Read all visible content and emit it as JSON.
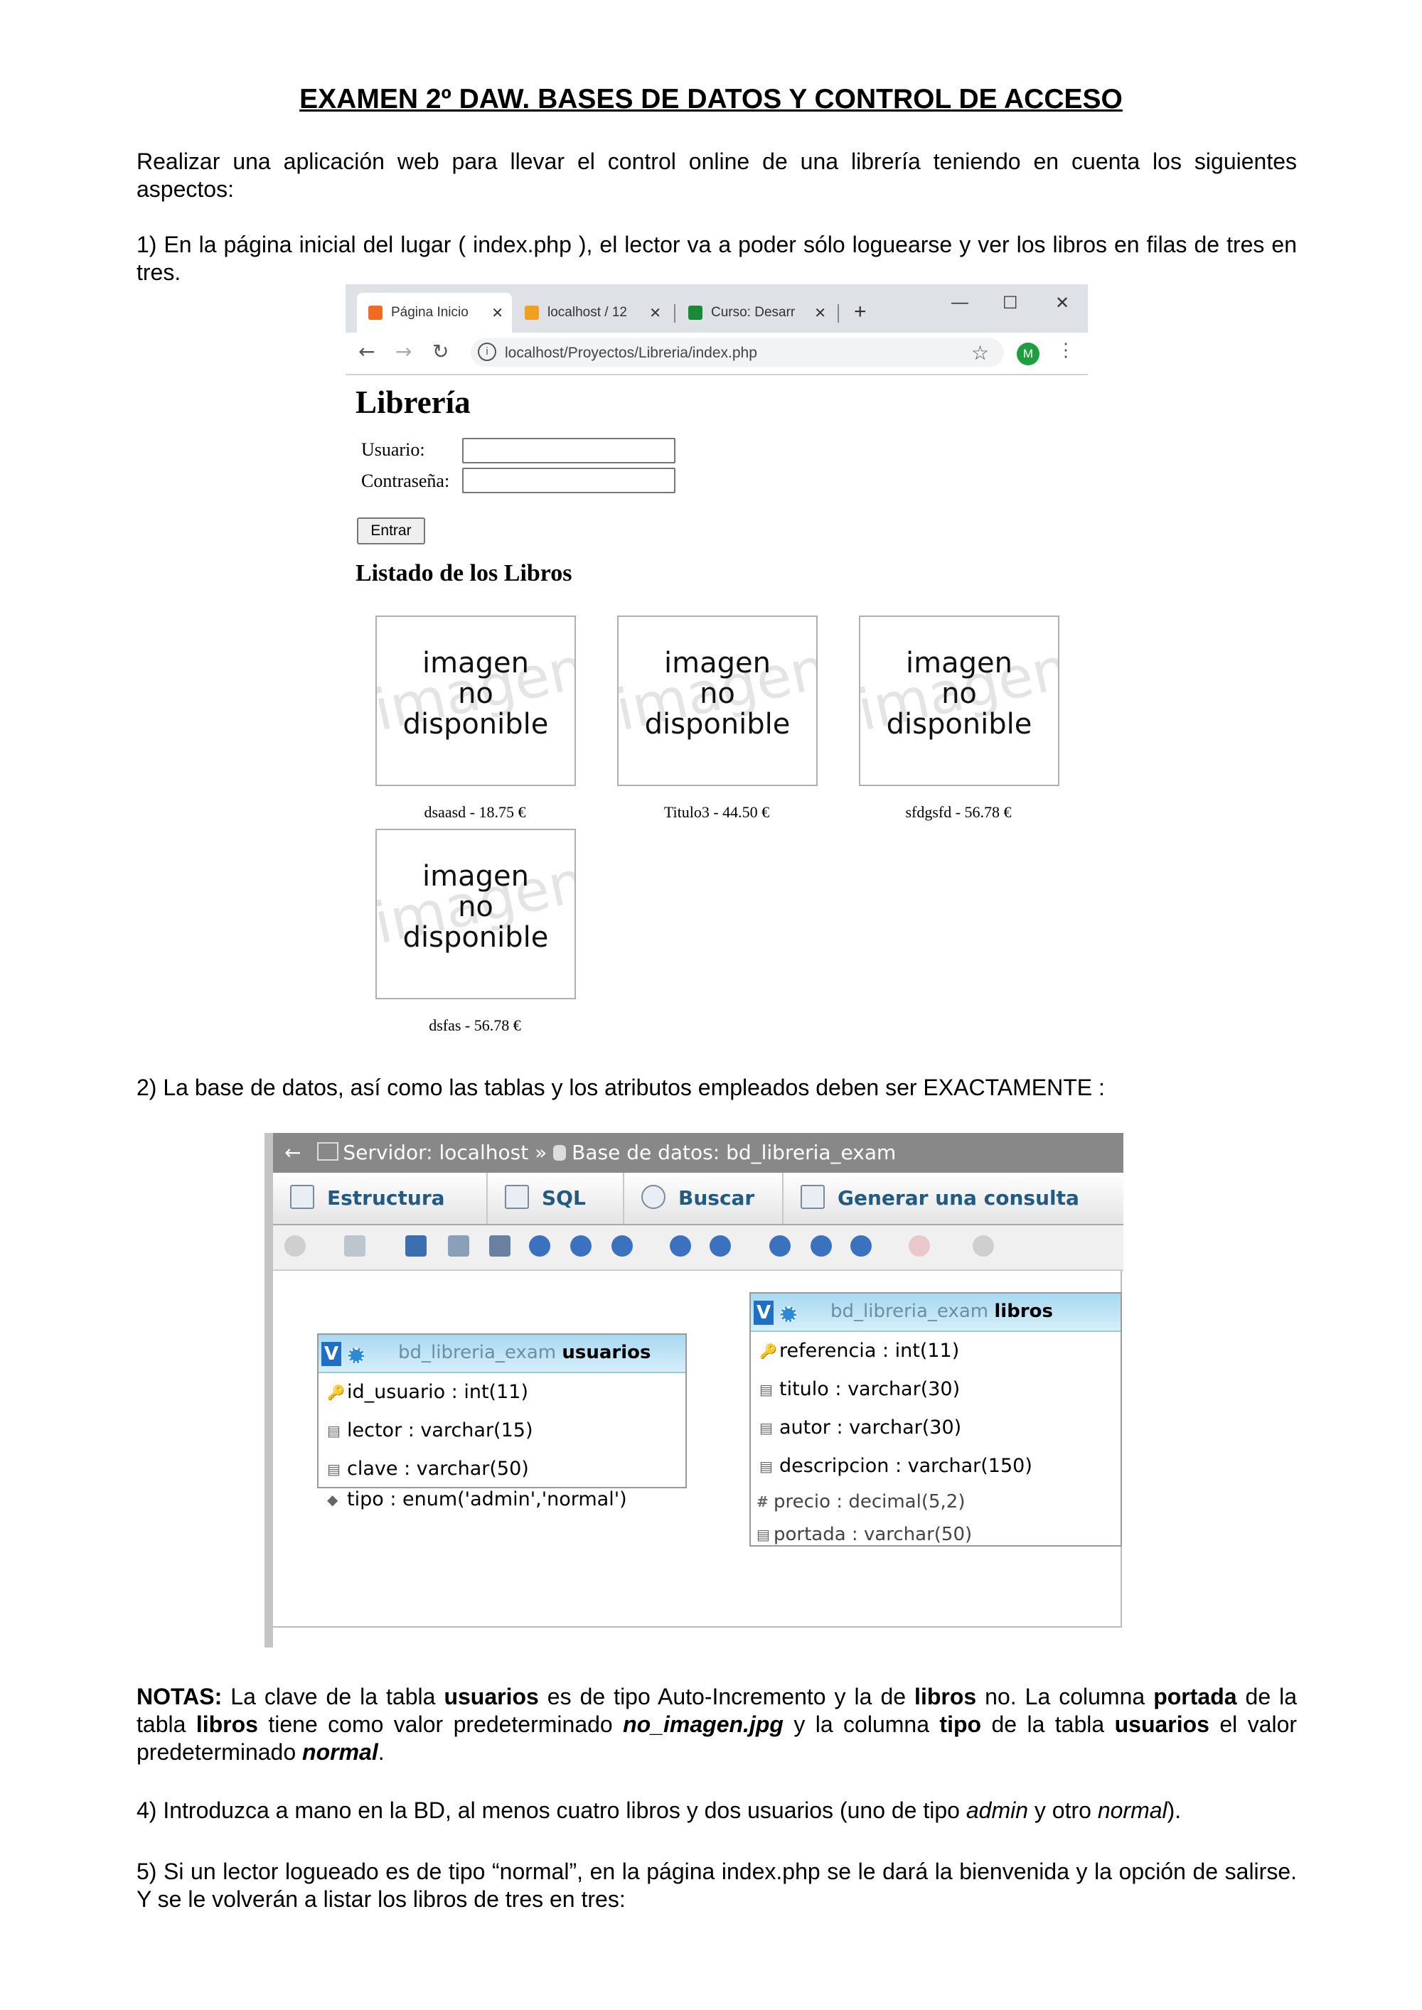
{
  "doc": {
    "title": "EXAMEN 2º DAW. BASES DE DATOS Y CONTROL DE ACCESO",
    "intro": "Realizar una aplicación web para llevar el control online de una librería teniendo en cuenta los siguientes aspectos:",
    "p1": "1) En la página inicial del lugar ( index.php ), el lector va a poder sólo loguearse y ver los libros en filas  de tres en tres.",
    "p2": "2) La base de datos, así como las tablas y los atributos empleados deben ser EXACTAMENTE :",
    "notes": {
      "label": "NOTAS:",
      "t1": " La clave de la tabla ",
      "b1": "usuarios",
      "t2": " es de tipo Auto-Incremento y la de ",
      "b2": "libros",
      "t3": " no. La columna ",
      "b3": "portada",
      "t4": " de la tabla ",
      "b4": "libros",
      "t5": " tiene como valor predeterminado ",
      "bi1": "no_imagen.jpg",
      "t6": " y la columna ",
      "b5": "tipo",
      "t7": " de la tabla ",
      "b6": "usuarios",
      "t8": " el valor predeterminado ",
      "bi2": "normal",
      "t9": "."
    },
    "p4": {
      "t1": "4) Introduzca a mano en la BD, al menos cuatro libros y dos usuarios (uno de tipo ",
      "i1": "admin",
      "t2": " y otro ",
      "i2": "normal",
      "t3": ")."
    },
    "p5": "5) Si un lector logueado es de tipo “normal”, en la página index.php se le dará la bienvenida y la opción de salirse. Y se le volverán a listar los libros de tres en tres:"
  },
  "browser": {
    "tabs": [
      {
        "label": "Página Inicio",
        "icon_color": "#f06a20"
      },
      {
        "label": "localhost / 12",
        "icon_color": "#f0a020"
      },
      {
        "label": "Curso: Desarr",
        "icon_color": "#1a8a3a"
      }
    ],
    "url": "localhost/Proyectos/Libreria/index.php",
    "avatar": "M",
    "page": {
      "heading": "Librería",
      "user_label": "Usuario:",
      "pass_label": "Contraseña:",
      "submit": "Entrar",
      "list_heading": "Listado de los Libros",
      "cover_text": [
        "imagen",
        "no",
        "disponible"
      ],
      "cover_watermark": "imagen disponible",
      "books": [
        "dsaasd - 18.75 €",
        "Titulo3 - 44.50 €",
        "sfdgsfd - 56.78 €",
        "dsfas - 56.78 €"
      ]
    }
  },
  "pma": {
    "breadcrumb": "Servidor: localhost » ",
    "breadcrumb_db": "Base de datos: bd_libreria_exam",
    "tabs": [
      "Estructura",
      "SQL",
      "Buscar",
      "Generar una consulta"
    ],
    "tables": {
      "usuarios": {
        "db": "bd_libreria_exam",
        "name": "usuarios",
        "columns": [
          "id_usuario : int(11)",
          "lector : varchar(15)",
          "clave : varchar(50)",
          "tipo : enum('admin','normal')"
        ]
      },
      "libros": {
        "db": "bd_libreria_exam",
        "name": "libros",
        "columns": [
          "referencia : int(11)",
          "titulo : varchar(30)",
          "autor : varchar(30)",
          "descripcion : varchar(150)",
          "precio : decimal(5,2)",
          "portada : varchar(50)"
        ]
      }
    },
    "accent": "#235a81"
  }
}
